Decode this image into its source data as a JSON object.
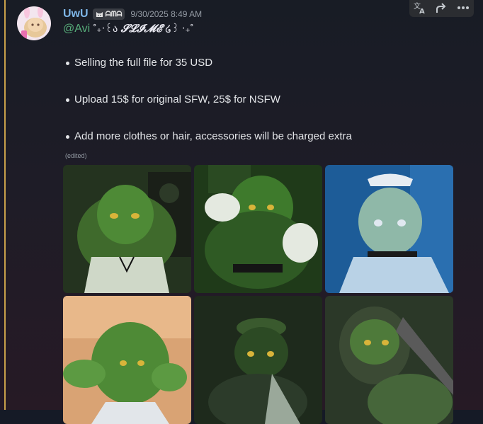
{
  "message": {
    "username": "UwU",
    "badge_icon": "cat-face-icon",
    "badge_text": "ᗩᗰᗩ",
    "timestamp": "9/30/2025 8:49 AM",
    "mention": "@Avi",
    "deco_left": "˚₊‧꒰ა",
    "deco_name": "𝓢𝓛𝓘𝓜𝓔",
    "deco_right": "໒꒱ ‧₊˚",
    "bullets": [
      "Selling the full file for 35 USD",
      "Upload 15$ for original SFW, 25$ for NSFW",
      "Add more clothes or hair, accessories will be charged extra"
    ],
    "edited": "(edited)"
  },
  "toolbar": {
    "icons": [
      "translate-icon",
      "forward-icon",
      "more-icon"
    ]
  },
  "attachments": {
    "count": 6,
    "colors": {
      "tile1": "#3f6a2c",
      "tile2": "#2f5a24",
      "tile3": "#2a6fb0",
      "tile4": "#d9a374",
      "tile5": "#2c3b2a",
      "tile6": "#3b4a34"
    }
  },
  "colors": {
    "username": "#7fb7e8",
    "mention": "#57ad7a",
    "mention_bar": "#c8a04a",
    "timestamp": "#949ba4"
  }
}
